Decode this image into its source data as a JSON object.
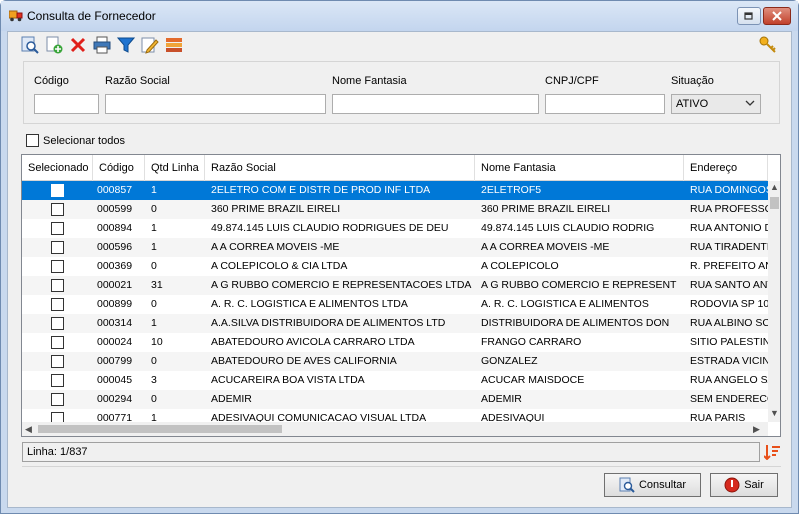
{
  "window": {
    "title": "Consulta de Fornecedor"
  },
  "toolbar": {
    "buttons": [
      "search-icon",
      "add-icon",
      "delete-icon",
      "print-icon",
      "filter-icon",
      "edit-icon",
      "export-icon"
    ],
    "key_icon": "key-icon"
  },
  "filters": {
    "codigo_label": "Código",
    "razao_label": "Razão Social",
    "fantasia_label": "Nome Fantasia",
    "cnpj_label": "CNPJ/CPF",
    "situacao_label": "Situação",
    "codigo_value": "",
    "razao_value": "",
    "fantasia_value": "",
    "cnpj_value": "",
    "situacao_value": "ATIVO"
  },
  "select_all_label": "Selecionar todos",
  "grid": {
    "columns": [
      "Selecionado",
      "Código",
      "Qtd Linha",
      "Razão Social",
      "Nome Fantasia",
      "Endereço"
    ],
    "rows": [
      {
        "codigo": "000857",
        "qtd": "1",
        "razao": "2ELETRO COM E DISTR DE PROD INF LTDA",
        "fantasia": "2ELETROF5",
        "endereco": "RUA DOMINGOS"
      },
      {
        "codigo": "000599",
        "qtd": "0",
        "razao": "360 PRIME BRAZIL EIRELI",
        "fantasia": "360 PRIME BRAZIL EIRELI",
        "endereco": "RUA PROFESSO"
      },
      {
        "codigo": "000894",
        "qtd": "1",
        "razao": "49.874.145 LUIS CLAUDIO RODRIGUES DE DEU",
        "fantasia": "49.874.145 LUIS CLAUDIO RODRIG",
        "endereco": "RUA ANTONIO D"
      },
      {
        "codigo": "000596",
        "qtd": "1",
        "razao": "A A CORREA MOVEIS -ME",
        "fantasia": "A A CORREA MOVEIS -ME",
        "endereco": "RUA TIRADENTE"
      },
      {
        "codigo": "000369",
        "qtd": "0",
        "razao": "A COLEPICOLO & CIA LTDA",
        "fantasia": "A COLEPICOLO",
        "endereco": "R. PREFEITO AN"
      },
      {
        "codigo": "000021",
        "qtd": "31",
        "razao": "A G RUBBO COMERCIO E REPRESENTACOES LTDA",
        "fantasia": "A G RUBBO COMERCIO E REPRESENT",
        "endereco": "RUA SANTO ANT"
      },
      {
        "codigo": "000899",
        "qtd": "0",
        "razao": "A. R. C. LOGISTICA E ALIMENTOS LTDA",
        "fantasia": "A. R. C. LOGISTICA E ALIMENTOS",
        "endereco": "RODOVIA SP 10"
      },
      {
        "codigo": "000314",
        "qtd": "1",
        "razao": "A.A.SILVA DISTRIBUIDORA DE ALIMENTOS LTD",
        "fantasia": "DISTRIBUIDORA DE ALIMENTOS DON",
        "endereco": "RUA ALBINO SC"
      },
      {
        "codigo": "000024",
        "qtd": "10",
        "razao": "ABATEDOURO AVICOLA CARRARO LTDA",
        "fantasia": "FRANGO CARRARO",
        "endereco": "SITIO PALESTIN"
      },
      {
        "codigo": "000799",
        "qtd": "0",
        "razao": "ABATEDOURO DE AVES CALIFORNIA",
        "fantasia": "GONZALEZ",
        "endereco": "ESTRADA VICIN"
      },
      {
        "codigo": "000045",
        "qtd": "3",
        "razao": "ACUCAREIRA BOA VISTA LTDA",
        "fantasia": "ACUCAR MAISDOCE",
        "endereco": "RUA ANGELO SA"
      },
      {
        "codigo": "000294",
        "qtd": "0",
        "razao": "ADEMIR",
        "fantasia": "ADEMIR",
        "endereco": "SEM ENDERECO"
      },
      {
        "codigo": "000771",
        "qtd": "1",
        "razao": "ADESIVAQUI COMUNICACAO VISUAL LTDA",
        "fantasia": "ADESIVAQUI",
        "endereco": "RUA PARIS"
      }
    ]
  },
  "status": {
    "text": "Linha: 1/837"
  },
  "buttons": {
    "consultar": "Consultar",
    "sair": "Sair"
  },
  "colors": {
    "selection": "#0078d7",
    "close": "#c1412b"
  }
}
